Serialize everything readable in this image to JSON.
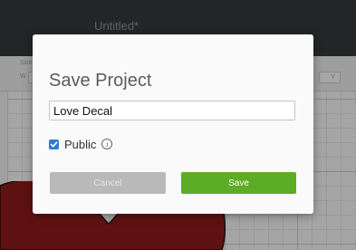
{
  "app": {
    "title": "Untitled*"
  },
  "toolbar": {
    "size_label": "Size",
    "w_label": "W",
    "y_label": "Y"
  },
  "dialog": {
    "title": "Save Project",
    "project_name_value": "Love Decal",
    "public_label": "Public",
    "public_checked": true,
    "info_icon_glyph": "i",
    "cancel_label": "Cancel",
    "save_label": "Save"
  },
  "colors": {
    "header_bg": "#33383a",
    "save_button": "#5cac25",
    "cancel_button": "#b9b9b9",
    "checkbox": "#2f7bd6",
    "heart": "#8b1a1a"
  },
  "icons": {
    "checkbox": "checkmark-icon",
    "info": "info-icon"
  }
}
